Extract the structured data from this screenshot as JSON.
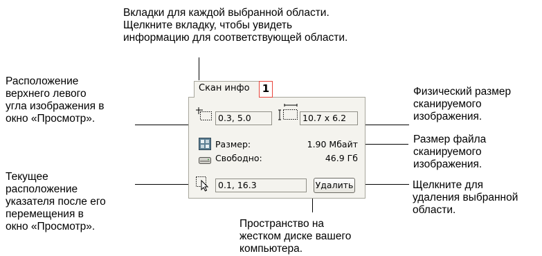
{
  "callouts": {
    "tabs": [
      "Вкладки для каждой выбранной области.",
      "Щелкните вкладку, чтобы увидеть",
      "информацию для соответствующей области."
    ],
    "position": [
      "Расположение",
      "верхнего левого",
      "угла изображения в",
      "окно «Просмотр»."
    ],
    "size": [
      "Физический размер",
      "сканируемого",
      "изображения."
    ],
    "filesize": [
      "Размер файла",
      "сканируемого",
      "изображения."
    ],
    "pointer": [
      "Текущее",
      "расположение",
      "указателя после его",
      "перемещения в",
      "окно «Просмотр»."
    ],
    "delete": [
      "Щелкните для",
      "удаления выбранной",
      "области."
    ],
    "disk": [
      "Пространство на",
      "жестком диске вашего",
      "компьютера."
    ]
  },
  "panel": {
    "tab_label": "Скан инфо",
    "tab_number": "1",
    "position_value": "0.3, 5.0",
    "size_value": "10.7 x 6.2",
    "size_label": "Размер:",
    "size_amount": "1.90 Мбайт",
    "free_label": "Свободно:",
    "free_amount": "46.9 Гб",
    "pointer_value": "0.1, 16.3",
    "delete_label": "Удалить"
  }
}
